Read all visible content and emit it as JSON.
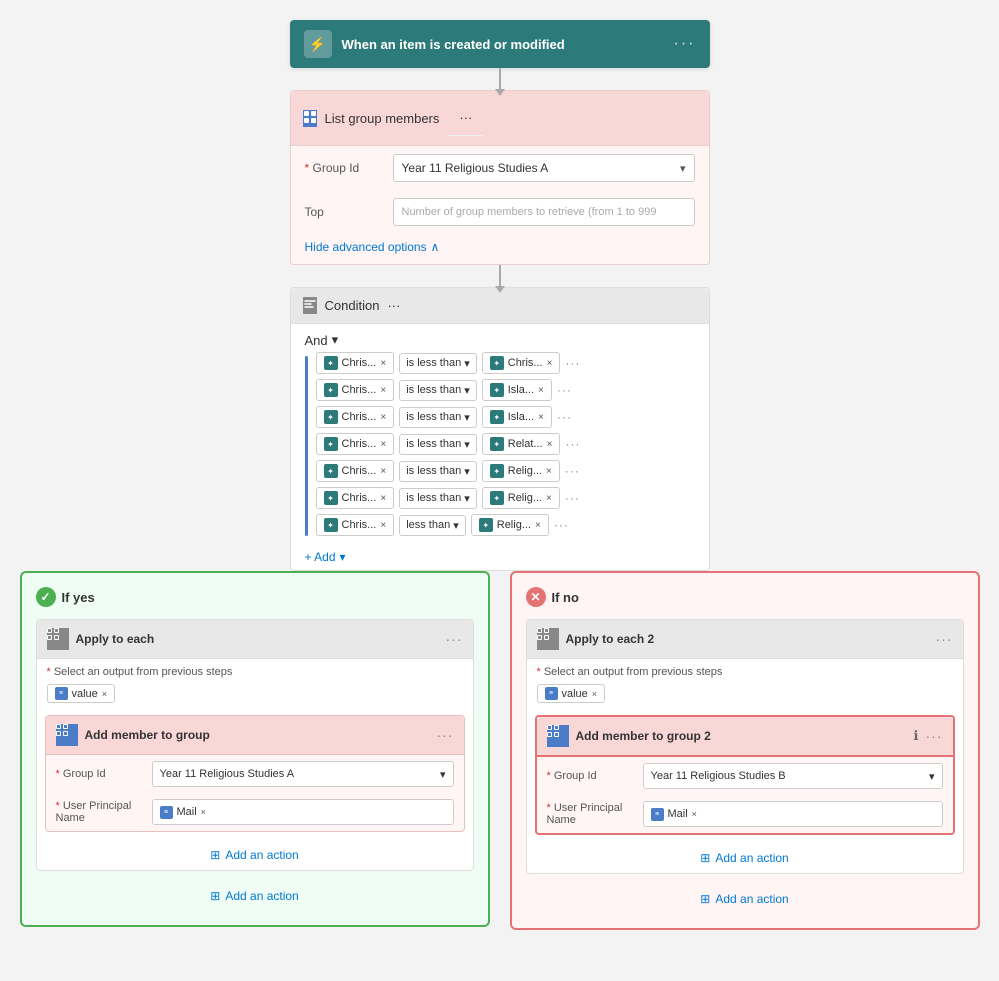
{
  "trigger": {
    "label": "When an item is created or modified",
    "more": "···"
  },
  "listGroup": {
    "title": "List group members",
    "groupIdLabel": "Group Id",
    "groupIdValue": "Year 11 Religious Studies A",
    "topLabel": "Top",
    "topPlaceholder": "Number of group members to retrieve (from 1 to 999",
    "hideAdvanced": "Hide advanced options",
    "required": "*",
    "more": "···"
  },
  "condition": {
    "title": "Condition",
    "andLabel": "And",
    "more": "···",
    "rows": [
      {
        "left": "Chris...",
        "operator": "is less than",
        "right": "Chris..."
      },
      {
        "left": "Chris...",
        "operator": "is less than",
        "right": "Isla..."
      },
      {
        "left": "Chris...",
        "operator": "is less than",
        "right": "Isla..."
      },
      {
        "left": "Chris...",
        "operator": "is less than",
        "right": "Relat..."
      },
      {
        "left": "Chris...",
        "operator": "is less than",
        "right": "Relig..."
      },
      {
        "left": "Chris...",
        "operator": "is less than",
        "right": "Relig..."
      },
      {
        "left": "Chris...",
        "operator": "less than",
        "right": "Relig..."
      }
    ],
    "addLabel": "+ Add"
  },
  "ifYes": {
    "branchLabel": "If yes",
    "applyToEach": {
      "title": "Apply to each",
      "more": "···",
      "selectLabel": "Select an output from previous steps",
      "valueChip": "value"
    },
    "addMember": {
      "title": "Add member to group",
      "more": "···",
      "groupIdLabel": "Group Id",
      "groupIdValue": "Year 11 Religious Studies A",
      "userPrincipalLabel": "User Principal Name",
      "mailChip": "Mail"
    },
    "addActionLabel": "Add an action"
  },
  "ifNo": {
    "branchLabel": "If no",
    "applyToEach": {
      "title": "Apply to each 2",
      "more": "···",
      "selectLabel": "Select an output from previous steps",
      "valueChip": "value"
    },
    "addMember": {
      "title": "Add member to group 2",
      "more": "···",
      "infoIcon": "ℹ",
      "groupIdLabel": "Group Id",
      "groupIdValue": "Year 11 Religious Studies B",
      "userPrincipalLabel": "User Principal Name",
      "mailChip": "Mail"
    },
    "addActionLabel": "Add an action"
  },
  "bottomAddAction": {
    "yes": "Add an action",
    "no": "Add an action"
  }
}
